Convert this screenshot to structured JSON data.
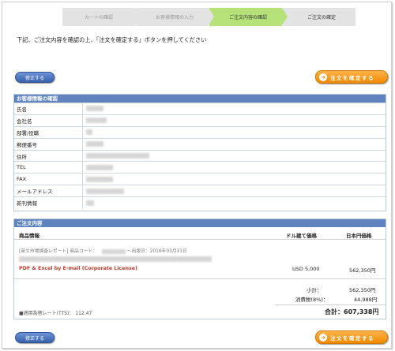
{
  "steps": [
    {
      "label": "カートの確認"
    },
    {
      "label": "お客様情報の入力"
    },
    {
      "label": "ご注文内容の確認"
    },
    {
      "label": "ご注文の確定"
    }
  ],
  "instruction": "下記、ご注文内容を確認の上、「注文を確定する」ボタンを押してください",
  "buttons": {
    "back": "修正する",
    "confirm": "注文を確定する",
    "confirm_icon": "➜"
  },
  "customer_section": {
    "title": "お客様情報の確認",
    "fields": [
      {
        "label": "氏名"
      },
      {
        "label": "会社名"
      },
      {
        "label": "部署/役職"
      },
      {
        "label": "郵便番号"
      },
      {
        "label": "住所"
      },
      {
        "label": "TEL"
      },
      {
        "label": "FAX"
      },
      {
        "label": "メールアドレス"
      },
      {
        "label": "新刊情報"
      }
    ]
  },
  "order_section": {
    "title": "ご注文内容",
    "col_product": "商品情報",
    "col_usd": "ドル建て価格",
    "col_jpy": "日本円価格",
    "item_meta": "[英文市場調査レポート] 商品コード：",
    "item_date": "～出版日：2016年03月31日",
    "product_title": "PDF & Excel by E-mail (Corporate License)",
    "usd_price": "USD 5,000",
    "jpy_price": "562,350円",
    "subtotal_label": "小計：",
    "subtotal_value": "562,350円",
    "tax_label": "消費税(8%)：",
    "tax_value": "44,988円",
    "rate_text": "■適用為替レート(TTS)： 112.47",
    "total_text": "合計：607,338円"
  },
  "colors": {
    "step_active": "#b6e27a",
    "header_blue": "#5f83bf",
    "confirm_orange": "#f08a00",
    "product_red": "#c0392b"
  }
}
